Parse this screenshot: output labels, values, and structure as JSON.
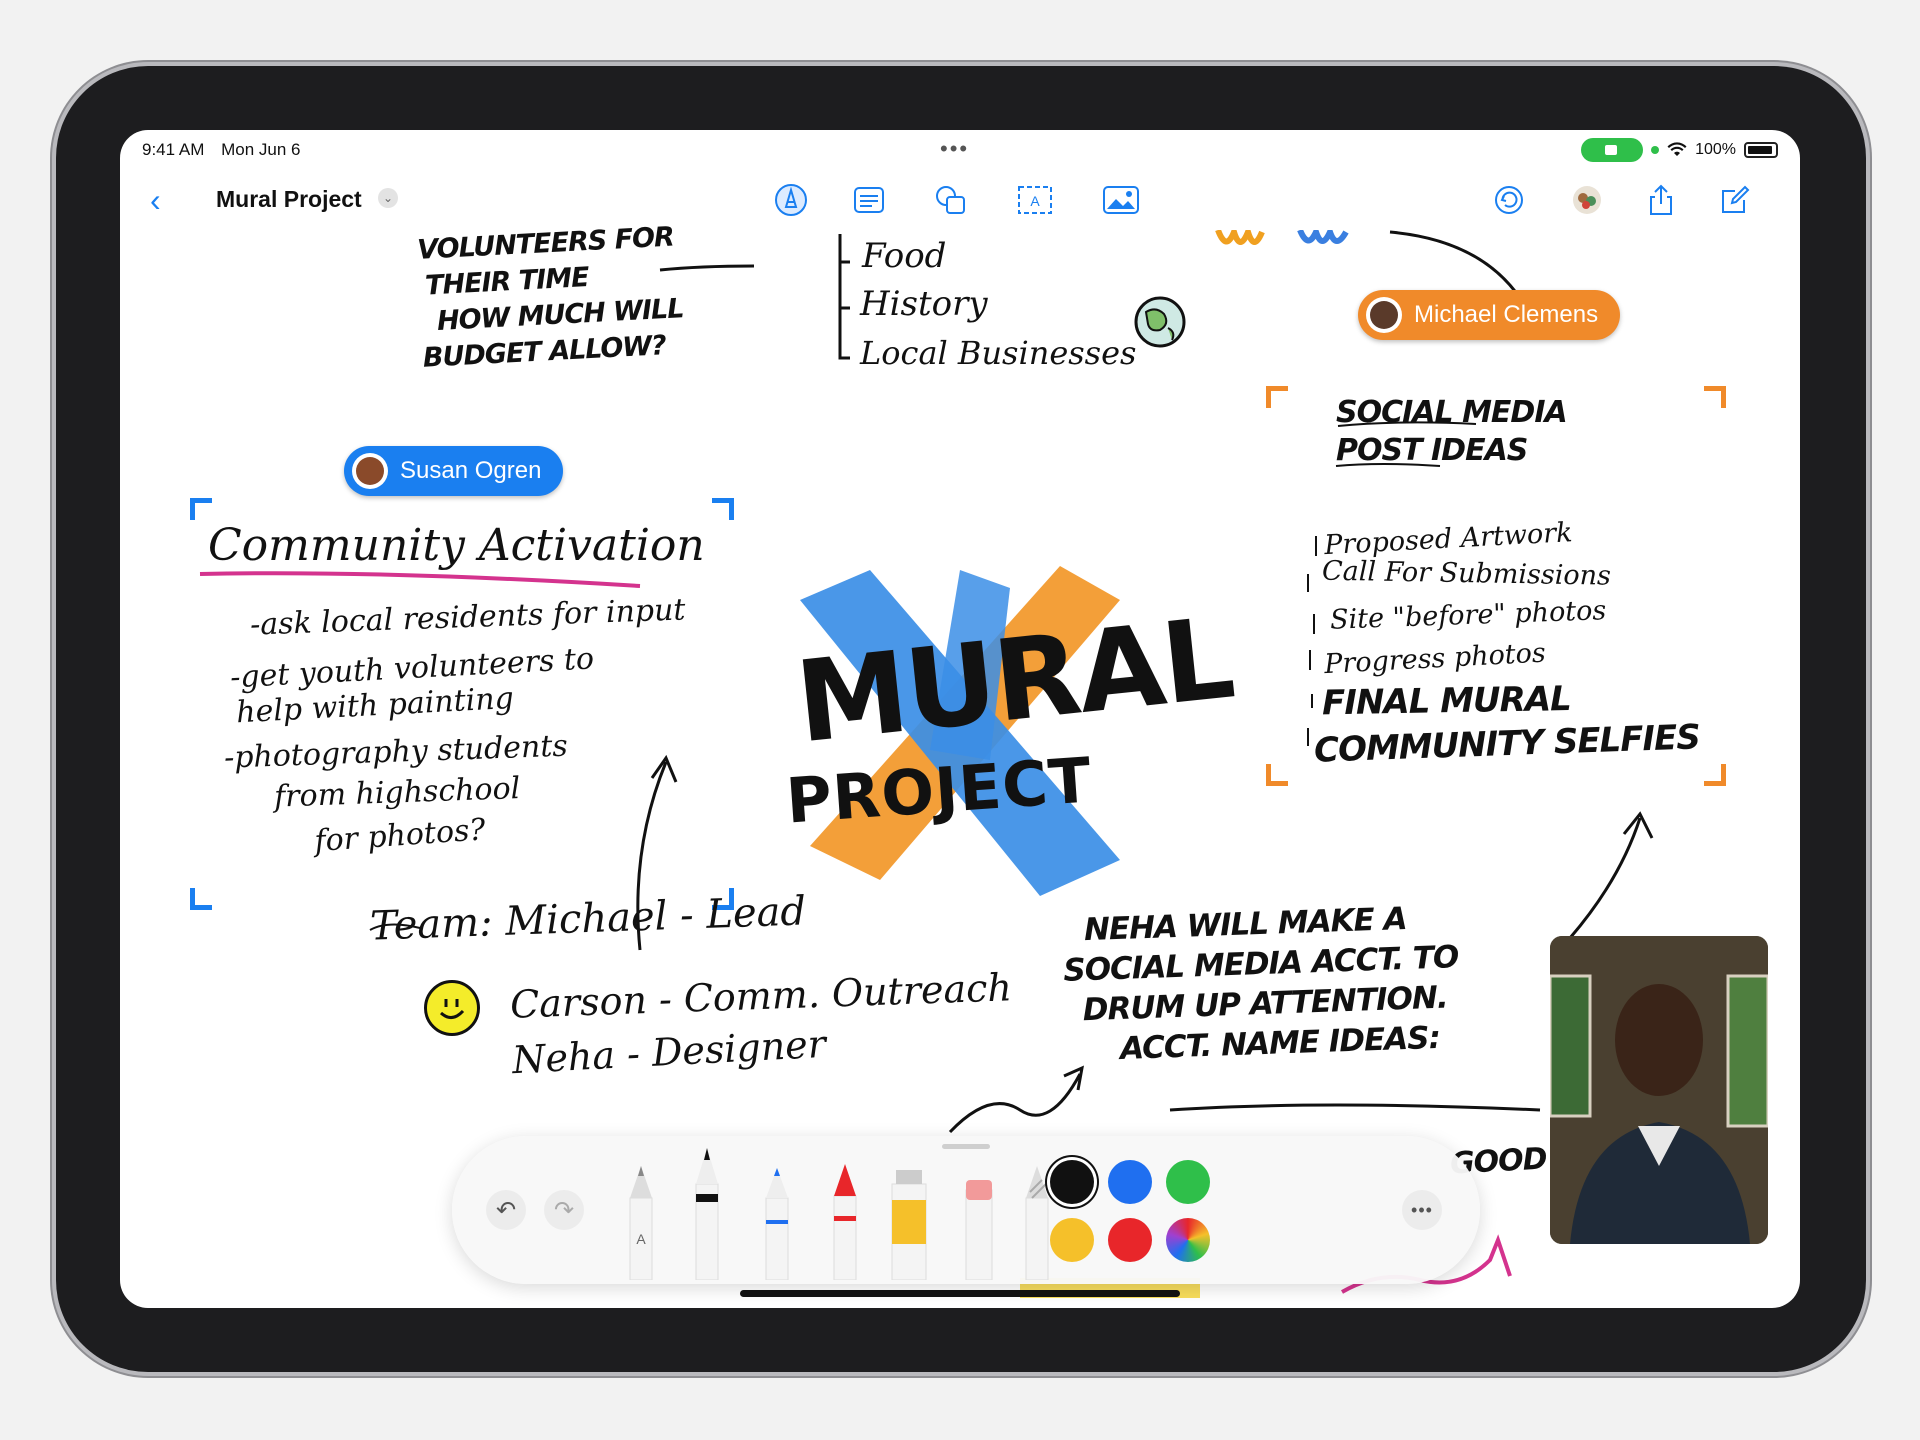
{
  "status_bar": {
    "time": "9:41 AM",
    "date": "Mon Jun 6",
    "battery": "100%"
  },
  "toolbar": {
    "title": "Mural Project",
    "icons": [
      "back-icon",
      "pencil-tip-icon",
      "text-box-icon",
      "shapes-icon",
      "text-frame-icon",
      "image-icon",
      "undo-history-icon",
      "collaborators-icon",
      "share-icon",
      "compose-icon"
    ]
  },
  "collaborators": {
    "susan": {
      "name": "Susan Ogren",
      "color": "#1a7ff0"
    },
    "michael": {
      "name": "Michael Clemens",
      "color": "#f08a2a"
    }
  },
  "board": {
    "top_left_note": [
      "VOLUNTEERS FOR",
      "THEIR TIME",
      "HOW MUCH WILL",
      "BUDGET ALLOW?"
    ],
    "top_list": [
      "Food",
      "History",
      "Local Businesses"
    ],
    "community": {
      "heading": "Community Activation",
      "lines": [
        "-ask local residents for input",
        "-get youth volunteers to",
        "help with painting",
        "-photography students",
        "from highschool",
        "for photos?"
      ]
    },
    "mural": {
      "line1": "MURAL",
      "line2": "PROJECT"
    },
    "social": {
      "heading_line1": "SOCIAL MEDIA",
      "heading_line2": "POST IDEAS",
      "items": [
        "Proposed Artwork",
        "Call For Submissions",
        "Site \"before\" photos",
        "Progress photos"
      ],
      "bold_items": [
        "FINAL MURAL",
        "COMMUNITY SELFIES"
      ]
    },
    "team": {
      "line1": "Team: Michael - Lead",
      "line2": "Carson - Comm. Outreach",
      "line3": "Neha - Designer"
    },
    "neha_note": [
      "NEHA WILL MAKE A",
      "SOCIAL MEDIA ACCT. TO",
      "DRUM UP ATTENTION.",
      "ACCT. NAME IDEAS:"
    ],
    "partial_bottom": "GOOD"
  },
  "palette": {
    "tools": [
      "undo",
      "redo",
      "monoline-pen",
      "fountain-pen",
      "marker",
      "crayon",
      "watercolor",
      "eraser",
      "ruler"
    ],
    "colors": [
      "#111111",
      "#1f6ff0",
      "#2fbf4a",
      "#f5c02a",
      "#e8262a",
      "multicolor"
    ],
    "more": "•••"
  },
  "call": {
    "participant": "facetime-video"
  }
}
